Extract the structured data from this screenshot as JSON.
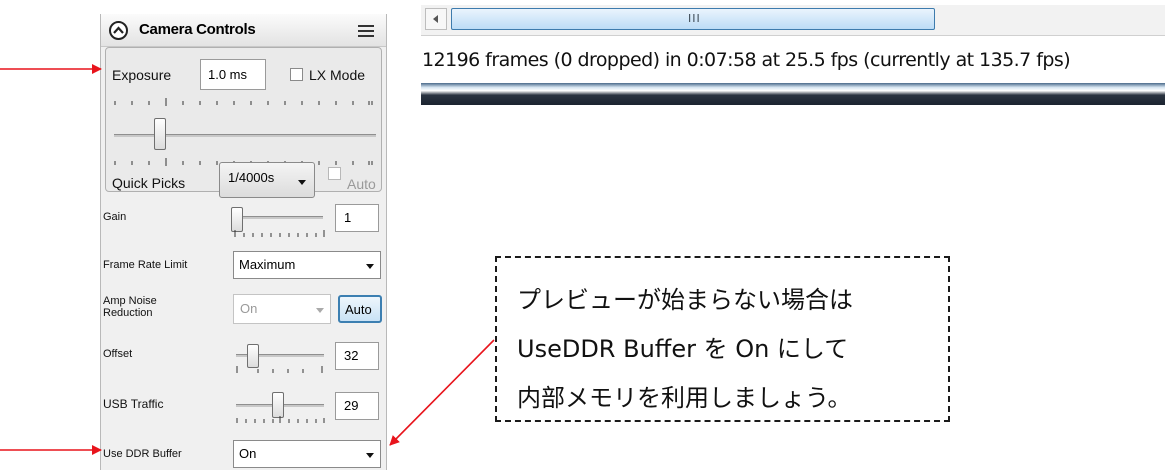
{
  "panel": {
    "title": "Camera Controls",
    "exposure": {
      "label": "Exposure",
      "value": "1.0 ms",
      "lx_mode_label": "LX Mode",
      "lx_mode_checked": false,
      "slider_fraction": 0.15,
      "quick_picks_label": "Quick Picks",
      "quick_picks_value": "1/4000s",
      "auto_label": "Auto",
      "auto_checked": false
    },
    "gain": {
      "label": "Gain",
      "value": "1",
      "slider_fraction": 0.0
    },
    "frame_rate_limit": {
      "label": "Frame Rate Limit",
      "value": "Maximum"
    },
    "amp_noise": {
      "label_line1": "Amp Noise",
      "label_line2": "Reduction",
      "value": "On",
      "auto_button": "Auto"
    },
    "offset": {
      "label": "Offset",
      "value": "32",
      "slider_fraction": 0.15
    },
    "usb_traffic": {
      "label": "USB Traffic",
      "value": "29",
      "slider_fraction": 0.47
    },
    "ddr_buffer": {
      "label": "Use DDR Buffer",
      "value": "On"
    }
  },
  "status": {
    "scroll_grip": "III",
    "text": "12196 frames (0 dropped) in 0:07:58 at 25.5 fps  (currently at 135.7 fps)"
  },
  "note": {
    "lines": [
      "プレビューが始まらない場合は",
      "UseDDR Buffer を On にして",
      "内部メモリを利用しましょう。"
    ]
  },
  "colors": {
    "arrow": "#e8141c",
    "auto_button_border": "#3c7fb1",
    "scroll_thumb": "#bcdcf6"
  }
}
